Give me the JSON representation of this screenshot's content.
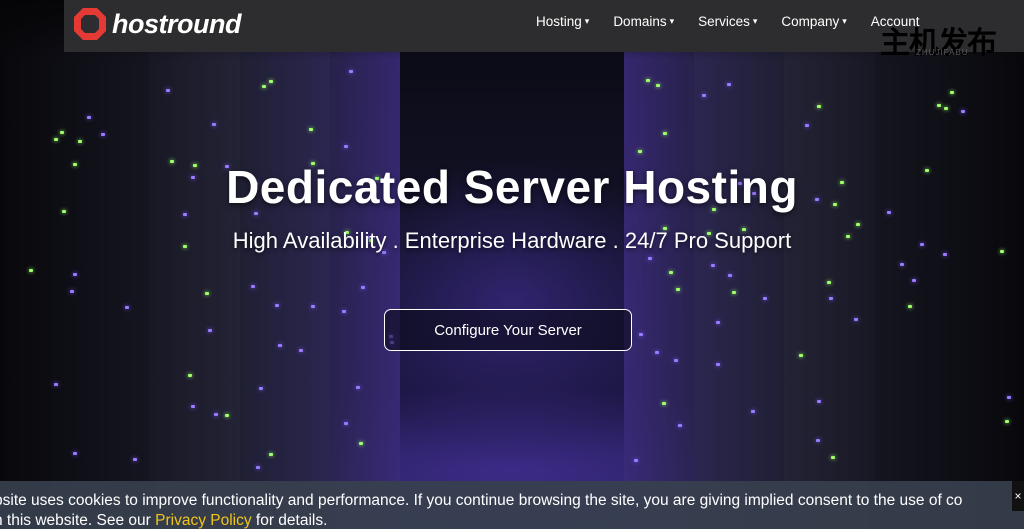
{
  "brand": {
    "name": "hostround",
    "logo_color": "#e53935"
  },
  "nav": {
    "items": [
      {
        "label": "Hosting",
        "caret": "▾"
      },
      {
        "label": "Domains",
        "caret": "▾"
      },
      {
        "label": "Services",
        "caret": "▾"
      },
      {
        "label": "Company",
        "caret": "▾"
      },
      {
        "label": "Account",
        "caret": ""
      }
    ]
  },
  "watermark": {
    "cn": "主机发布",
    "en": "ZHUJIFABU"
  },
  "hero": {
    "title": "Dedicated Server Hosting",
    "subtitle": "High Availability . Enterprise Hardware . 24/7 Pro Support",
    "cta_label": "Configure Your Server"
  },
  "cookie": {
    "line1": "bsite uses cookies to improve functionality and performance. If you continue browsing the site, you are giving implied consent to the use of co",
    "line2_prefix": "n this website. See our ",
    "link_label": "Privacy Policy",
    "line2_suffix": " for details.",
    "close_label": "×",
    "link_color": "#f0c419"
  },
  "colors": {
    "topbar": "#2d2d2f",
    "cookie_bg": "#37404e"
  }
}
